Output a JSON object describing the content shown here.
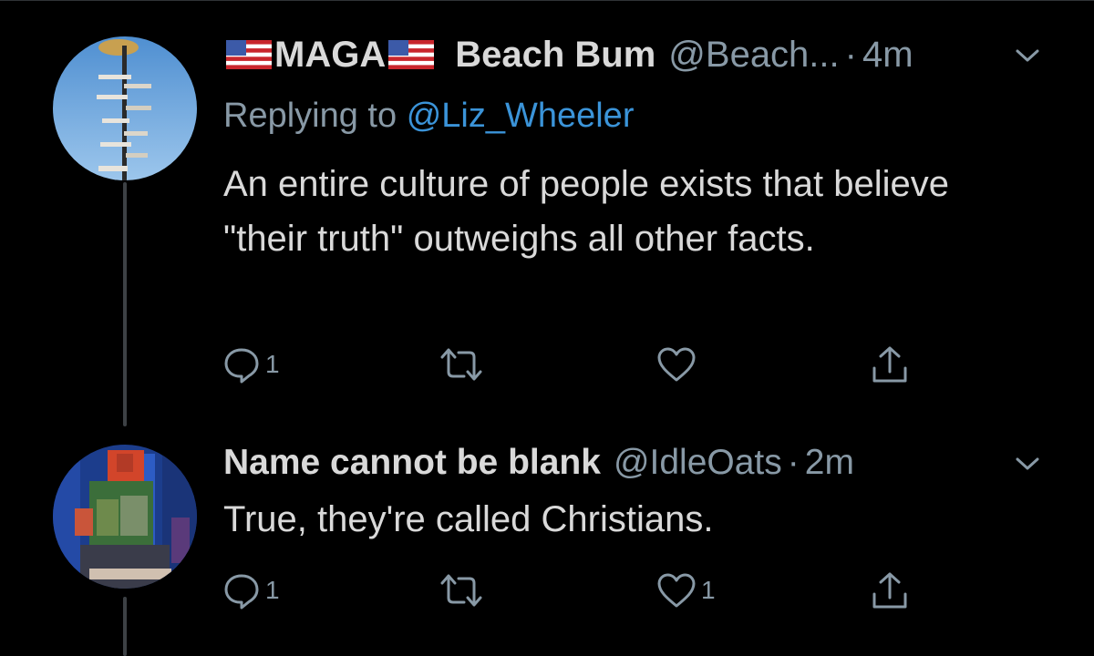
{
  "tweets": [
    {
      "name": "MAGA",
      "name_tail": "Beach Bum",
      "handle": "@Beach...",
      "dot": "·",
      "time": "4m",
      "replying_label": "Replying to",
      "replying_mention": "@Liz_Wheeler",
      "text": "An entire culture of people exists that believe \"their truth\" outweighs all other facts.",
      "actions": {
        "reply": "1",
        "retweet": "",
        "like": "",
        "share": ""
      }
    },
    {
      "name": "Name cannot be blank",
      "handle": "@IdleOats",
      "dot": "·",
      "time": "2m",
      "text": "True, they're called Christians.",
      "actions": {
        "reply": "1",
        "retweet": "",
        "like": "1",
        "share": ""
      }
    }
  ],
  "colors": {
    "background": "#000000",
    "text": "#d9d9d9",
    "secondary": "#8899a6",
    "mention": "#3b94d9",
    "thread_line": "#3d4145"
  }
}
